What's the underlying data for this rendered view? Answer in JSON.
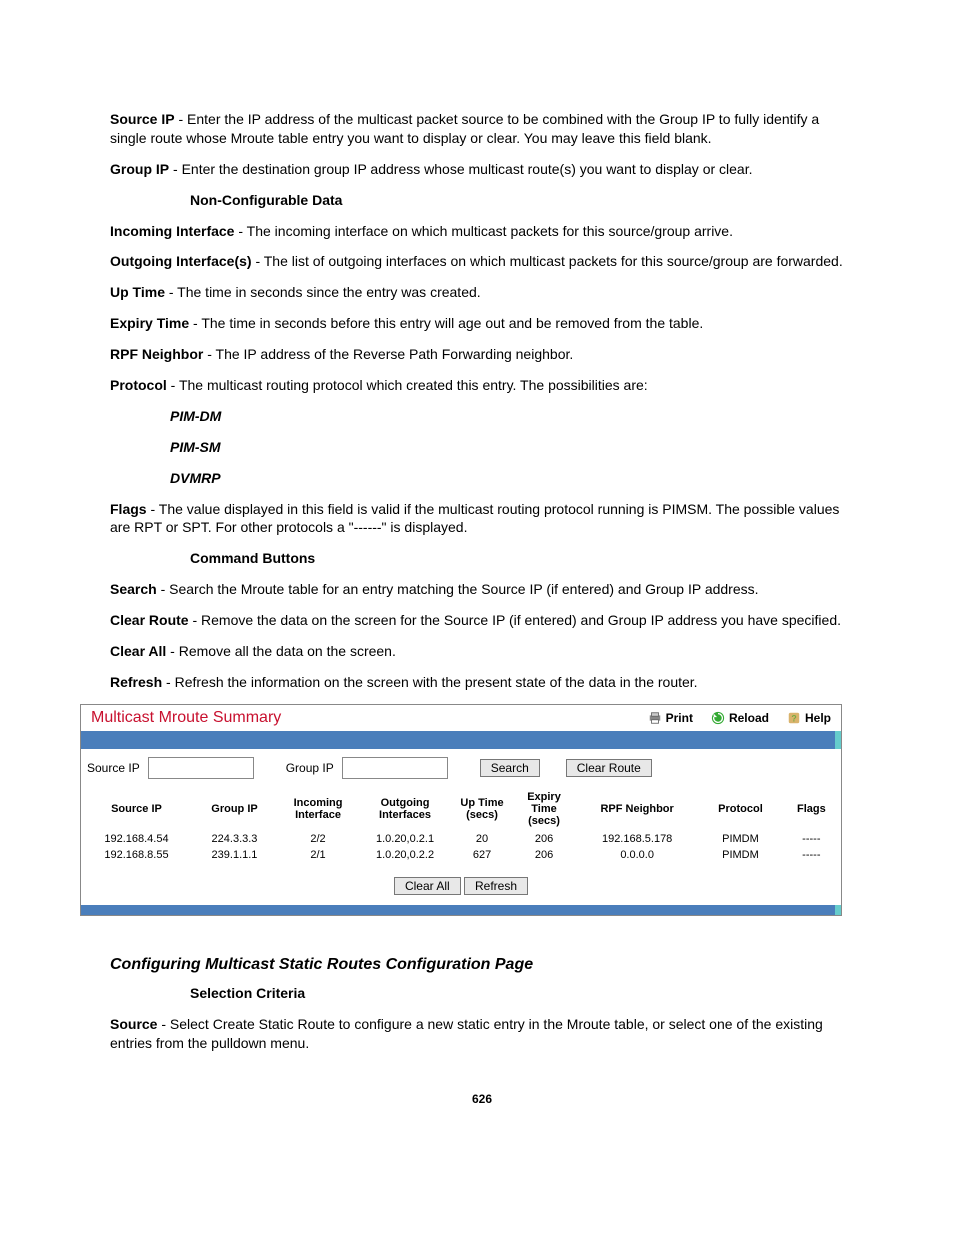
{
  "doc": {
    "source_ip_label": "Source IP",
    "source_ip_desc": " - Enter the IP address of the multicast packet source to be combined with the Group IP to fully identify a single route whose Mroute table entry you want to display or clear. You may leave this field blank.",
    "group_ip_label": "Group IP",
    "group_ip_desc": " - Enter the destination group IP address whose multicast route(s) you want to display or clear.",
    "noncfg_heading": "Non-Configurable Data",
    "incoming_if_label": "Incoming Interface",
    "incoming_if_desc": " - The incoming interface on which multicast packets for this source/group arrive.",
    "outgoing_if_label": "Outgoing Interface(s)",
    "outgoing_if_desc": " - The list of outgoing interfaces on which multicast packets for this source/group are forwarded.",
    "uptime_label": "Up Time",
    "uptime_desc": " - The time in seconds since the entry was created.",
    "expiry_label": "Expiry Time",
    "expiry_desc": " - The time in seconds before this entry will age out and be removed from the table.",
    "rpf_label": "RPF Neighbor",
    "rpf_desc": " - The IP address of the Reverse Path Forwarding neighbor.",
    "protocol_label": "Protocol",
    "protocol_desc": " - The multicast routing protocol which created this entry. The possibilities are:",
    "proto_pimdm": "PIM-DM",
    "proto_pimsm": "PIM-SM",
    "proto_dvmrp": "DVMRP",
    "flags_label": "Flags",
    "flags_desc": " - The value displayed in this field is valid if the multicast routing protocol running is PIMSM. The possible values are RPT or SPT. For other protocols a \"------\" is displayed.",
    "cmd_heading": "Command Buttons",
    "search_label": "Search",
    "search_desc": " - Search the Mroute table for an entry matching the Source IP (if entered) and Group IP address.",
    "clearroute_label": "Clear Route",
    "clearroute_desc": " - Remove the data on the screen for the Source IP (if entered) and Group IP address you have specified.",
    "clearall_label": "Clear All",
    "clearall_desc": " - Remove all the data on the screen.",
    "refresh_label": "Refresh",
    "refresh_desc": " - Refresh the information on the screen with the present state of the data in the router.",
    "section2_title": "Configuring Multicast Static Routes Configuration Page",
    "selcrit_heading": "Selection Criteria",
    "source_label": "Source",
    "source_desc": " - Select Create Static Route to configure a new static entry in the Mroute table, or select one of the existing entries from the pulldown menu.",
    "pagenum": "626"
  },
  "panel": {
    "title": "Multicast Mroute Summary",
    "actions": {
      "print": "Print",
      "reload": "Reload",
      "help": "Help"
    },
    "search": {
      "source_ip_label": "Source IP",
      "group_ip_label": "Group IP",
      "search_btn": "Search",
      "clear_route_btn": "Clear Route"
    },
    "table": {
      "headers": {
        "source_ip": "Source IP",
        "group_ip": "Group IP",
        "incoming": "Incoming Interface",
        "outgoing": "Outgoing Interfaces",
        "uptime": "Up Time (secs)",
        "expiry": "Expiry Time (secs)",
        "rpf": "RPF Neighbor",
        "protocol": "Protocol",
        "flags": "Flags"
      },
      "rows": [
        {
          "source_ip": "192.168.4.54",
          "group_ip": "224.3.3.3",
          "incoming": "2/2",
          "outgoing": "1.0.20,0.2.1",
          "uptime": "20",
          "expiry": "206",
          "rpf": "192.168.5.178",
          "protocol": "PIMDM",
          "flags": "-----"
        },
        {
          "source_ip": "192.168.8.55",
          "group_ip": "239.1.1.1",
          "incoming": "2/1",
          "outgoing": "1.0.20,0.2.2",
          "uptime": "627",
          "expiry": "206",
          "rpf": "0.0.0.0",
          "protocol": "PIMDM",
          "flags": "-----"
        }
      ]
    },
    "bottom": {
      "clear_all": "Clear All",
      "refresh": "Refresh"
    }
  }
}
